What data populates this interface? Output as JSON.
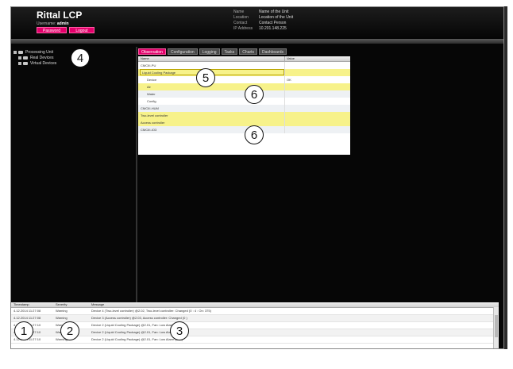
{
  "header": {
    "title": "Rittal LCP",
    "username_label": "Username:",
    "username": "admin",
    "password_button": "Password",
    "logout_button": "Logout",
    "info": [
      {
        "label": "Name",
        "value": "Name of the Unit"
      },
      {
        "label": "Location",
        "value": "Location of the Unit"
      },
      {
        "label": "Contact",
        "value": "Contact Person"
      },
      {
        "label": "IP Address",
        "value": "10.201.148.225"
      }
    ]
  },
  "tree": {
    "root": "Processing Unit",
    "children": [
      "Real Devices",
      "Virtual Devices"
    ]
  },
  "tabs": [
    "Observation",
    "Configuration",
    "Logging",
    "Tasks",
    "Charts",
    "Dashboards"
  ],
  "grid": {
    "col_name": "Name",
    "col_value": "Value",
    "rows": [
      {
        "label": "CMCIII-PU",
        "value": ""
      },
      {
        "label": "Liquid Cooling Package",
        "value": ""
      },
      {
        "label": "Device",
        "value": "OK"
      },
      {
        "label": "Air",
        "value": ""
      },
      {
        "label": "Water",
        "value": ""
      },
      {
        "label": "Config",
        "value": ""
      },
      {
        "label": "CMCIII-HUM",
        "value": ""
      },
      {
        "label": "Two-level controller",
        "value": ""
      },
      {
        "label": "Access controller",
        "value": ""
      },
      {
        "label": "CMCIII-IO3",
        "value": ""
      }
    ]
  },
  "log": {
    "columns": [
      "Timestamp",
      "Severity",
      "Message"
    ],
    "rows": [
      {
        "time": "4.12.2014 11:27:08",
        "severity": "Warning",
        "message": "Device 4 (Two-level controller) @2.02, Two-level controller: Changed (0 : 4 : On: 375)"
      },
      {
        "time": "4.12.2014 11:27:08",
        "severity": "Warning",
        "message": "Device 3 (Access controller) @2.03, Access controller: Changed (0 )"
      },
      {
        "time": "4.12.2014 11:27:10",
        "severity": "Warning",
        "message": "Device 2 (Liquid Cooling Package) @2.01, Fan: Low Alarm (0 %)"
      },
      {
        "time": "4.12.2014 11:27:10",
        "severity": "Warning",
        "message": "Device 2 (Liquid Cooling Package) @2.01, Fan: Low Alarm (0 %)"
      },
      {
        "time": "4.12.2014 11:27:10",
        "severity": "Warning",
        "message": "Device 2 (Liquid Cooling Package) @2.01, Fan: Low Alarm (0 %)"
      }
    ]
  },
  "callouts": [
    "1",
    "2",
    "3",
    "4",
    "5",
    "6",
    "6"
  ],
  "colors": {
    "accent": "#e3006b",
    "highlight": "#f7f28a",
    "background": "#060606"
  }
}
